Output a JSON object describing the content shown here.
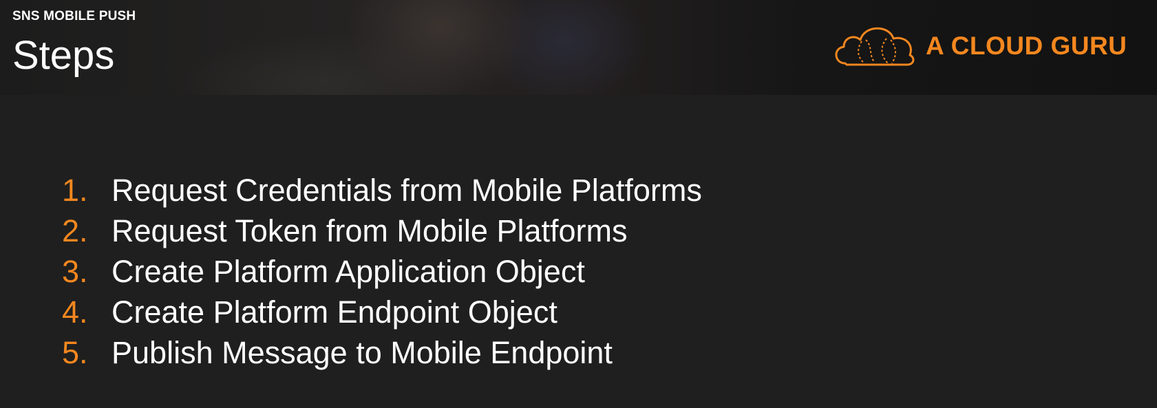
{
  "header": {
    "subtitle": "SNS MOBILE PUSH",
    "title": "Steps"
  },
  "logo": {
    "text": "A CLOUD GURU",
    "icon": "cloud-icon",
    "color": "#f4871f"
  },
  "steps": [
    {
      "number": "1.",
      "text": "Request Credentials from Mobile Platforms"
    },
    {
      "number": "2.",
      "text": "Request Token from Mobile Platforms"
    },
    {
      "number": "3.",
      "text": "Create Platform Application Object"
    },
    {
      "number": "4.",
      "text": "Create Platform Endpoint Object"
    },
    {
      "number": "5.",
      "text": "Publish Message to Mobile Endpoint"
    }
  ],
  "colors": {
    "accent": "#f4871f",
    "background": "#1f1f1f",
    "text": "#ffffff"
  }
}
